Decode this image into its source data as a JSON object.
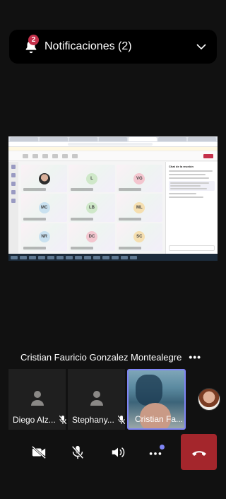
{
  "notification": {
    "title": "Notificaciones (2)",
    "badge_count": "2"
  },
  "shared_screen": {
    "chat_title": "Chat de la reunión",
    "tiles": [
      {
        "initials": "",
        "color": "#e8e8e8",
        "photo": true
      },
      {
        "initials": "L",
        "color": "#cfe8c9"
      },
      {
        "initials": "VG",
        "color": "#f3c6cf"
      },
      {
        "initials": "MC",
        "color": "#c9e1f0"
      },
      {
        "initials": "LB",
        "color": "#cfe8c9"
      },
      {
        "initials": "ML",
        "color": "#f5dfb0"
      },
      {
        "initials": "NR",
        "color": "#c9e1f0"
      },
      {
        "initials": "DC",
        "color": "#f3c6cf"
      },
      {
        "initials": "SC",
        "color": "#f5dfb0"
      }
    ]
  },
  "active_speaker": {
    "name": "Cristian Fauricio Gonzalez Montealegre",
    "more_label": "•••"
  },
  "participants": [
    {
      "label": "Diego Alz...",
      "muted": true
    },
    {
      "label": "Stephany...",
      "muted": true
    },
    {
      "label": "Cristian Fa...",
      "muted": false,
      "pinned": true
    }
  ],
  "colors": {
    "accent": "#7f85f5",
    "hangup": "#a4262c",
    "badge": "#c4314b"
  }
}
